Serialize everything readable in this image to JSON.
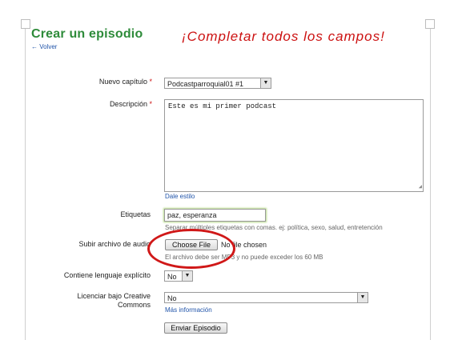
{
  "page": {
    "title": "Crear un episodio",
    "back_link": "← Volver",
    "overlay_note": "¡Completar todos los campos!"
  },
  "form": {
    "chapter": {
      "label": "Nuevo capítulo",
      "required_mark": "*",
      "value": "Podcastparroquial01 #1"
    },
    "description": {
      "label": "Descripción",
      "required_mark": "*",
      "value": "Este es mi primer podcast",
      "style_link": "Dale estilo"
    },
    "tags": {
      "label": "Etiquetas",
      "value": "paz, esperanza",
      "hint": "Separar múltiples etiquetas con comas. ej: política, sexo, salud, entretención"
    },
    "audio": {
      "label": "Subir archivo de audio",
      "button": "Choose File",
      "status": "No file chosen",
      "hint": "El archivo debe ser MP3 y no puede exceder los 60 MB"
    },
    "explicit": {
      "label": "Contiene lenguaje explícito",
      "value": "No"
    },
    "license": {
      "label_line1": "Licenciar bajo Creative",
      "label_line2": "Commons",
      "value": "No",
      "more_link": "Más información"
    },
    "submit": "Enviar Episodio"
  },
  "colors": {
    "title": "#2e8b3a",
    "overlay": "#cc1111",
    "link": "#2255aa",
    "circle": "#d01818"
  }
}
